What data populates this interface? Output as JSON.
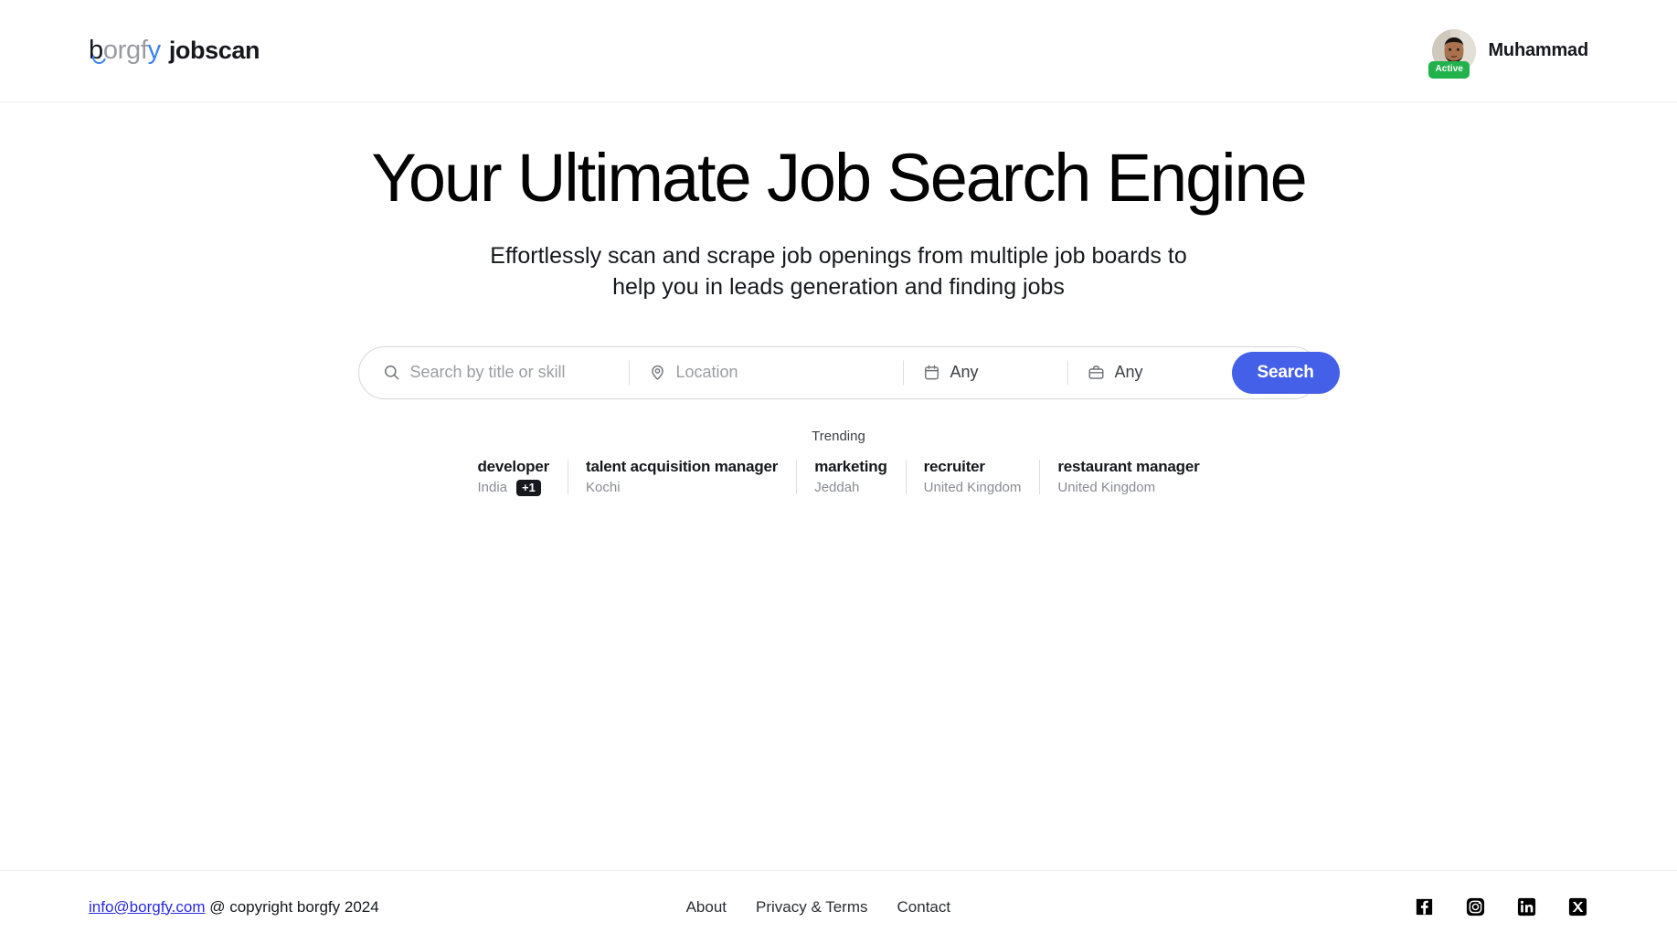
{
  "header": {
    "logo": {
      "mark_b": "b",
      "mark_orgf": "orgf",
      "mark_y": "y",
      "word": "jobscan"
    },
    "user": {
      "name": "Muhammad",
      "status_badge": "Active",
      "avatar_icon": "user-avatar-photo"
    }
  },
  "hero": {
    "title": "Your Ultimate Job Search Engine",
    "subtitle": "Effortlessly scan and scrape job openings from multiple job boards to help you in leads generation and finding jobs"
  },
  "search": {
    "keyword": {
      "icon": "search-icon",
      "value": "",
      "placeholder": "Search by title or skill"
    },
    "location": {
      "icon": "location-pin-icon",
      "value": "",
      "placeholder": "Location"
    },
    "date_posted": {
      "icon": "calendar-icon",
      "value": "Any"
    },
    "job_type": {
      "icon": "briefcase-icon",
      "value": "Any"
    },
    "submit_label": "Search",
    "accent_color": "#4560e8"
  },
  "trending": {
    "label": "Trending",
    "items": [
      {
        "title": "developer",
        "location": "India",
        "more": "+1"
      },
      {
        "title": "talent acquisition manager",
        "location": "Kochi",
        "more": ""
      },
      {
        "title": "marketing",
        "location": "Jeddah",
        "more": ""
      },
      {
        "title": "recruiter",
        "location": "United Kingdom",
        "more": ""
      },
      {
        "title": "restaurant manager",
        "location": "United Kingdom",
        "more": ""
      }
    ]
  },
  "footer": {
    "email": "info@borgfy.com",
    "copyright": " @ copyright borgfy 2024",
    "nav": [
      {
        "label": "About"
      },
      {
        "label": "Privacy & Terms"
      },
      {
        "label": "Contact"
      }
    ],
    "social": [
      {
        "name": "facebook-icon"
      },
      {
        "name": "instagram-icon"
      },
      {
        "name": "linkedin-icon"
      },
      {
        "name": "x-twitter-icon"
      }
    ]
  }
}
